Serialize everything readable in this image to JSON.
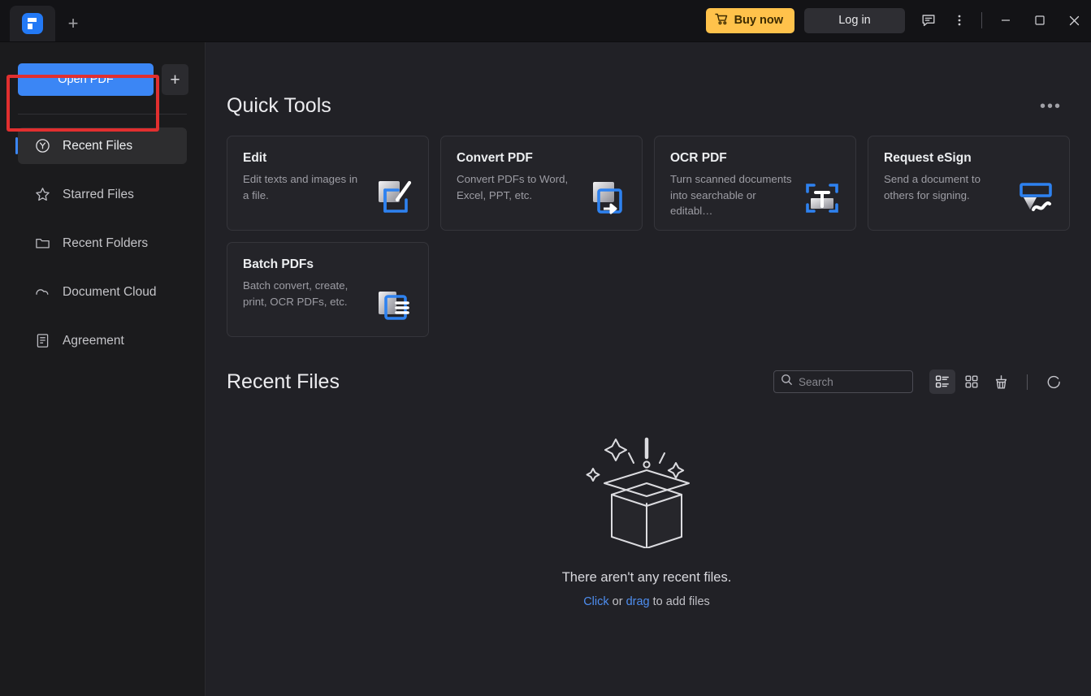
{
  "window": {
    "tab_icon": "app-logo-icon",
    "new_tab_label": "+",
    "buy_now_label": "Buy now",
    "login_label": "Log in",
    "feedback_icon": "feedback-icon",
    "more_icon": "more-vertical-icon",
    "minimize_icon": "minimize-icon",
    "maximize_icon": "maximize-icon",
    "close_icon": "close-icon",
    "accent_buy": "#ffc24b",
    "accent_blue": "#3b86f5"
  },
  "sidebar": {
    "open_pdf_label": "Open PDF",
    "add_label": "+",
    "items": [
      {
        "label": "Recent Files",
        "icon": "clock-icon",
        "active": true
      },
      {
        "label": "Starred Files",
        "icon": "star-icon",
        "active": false
      },
      {
        "label": "Recent Folders",
        "icon": "folder-icon",
        "active": false
      },
      {
        "label": "Document Cloud",
        "icon": "cloud-icon",
        "active": false
      },
      {
        "label": "Agreement",
        "icon": "document-icon",
        "active": false
      }
    ],
    "annotation_color": "#e22f2f"
  },
  "quick_tools": {
    "title": "Quick Tools",
    "more_label": "•••",
    "cards": [
      {
        "title": "Edit",
        "desc": "Edit texts and images in a file.",
        "icon": "edit-pdf-icon"
      },
      {
        "title": "Convert PDF",
        "desc": "Convert PDFs to Word, Excel, PPT, etc.",
        "icon": "convert-pdf-icon"
      },
      {
        "title": "OCR PDF",
        "desc": "Turn scanned documents into searchable or editabl…",
        "icon": "ocr-pdf-icon"
      },
      {
        "title": "Request eSign",
        "desc": "Send a document to others for signing.",
        "icon": "esign-icon"
      },
      {
        "title": "Batch PDFs",
        "desc": "Batch convert, create, print, OCR PDFs, etc.",
        "icon": "batch-pdf-icon"
      }
    ]
  },
  "recent": {
    "title": "Recent Files",
    "search_placeholder": "Search",
    "search_value": "",
    "search_icon": "search-icon",
    "list_view_icon": "list-view-icon",
    "grid_view_icon": "grid-view-icon",
    "clear_icon": "broom-icon",
    "refresh_icon": "refresh-icon",
    "empty_title": "There aren't any recent files.",
    "empty_prefix": "",
    "empty_click": "Click",
    "empty_middle": " or ",
    "empty_drag": "drag",
    "empty_suffix": " to add files"
  }
}
